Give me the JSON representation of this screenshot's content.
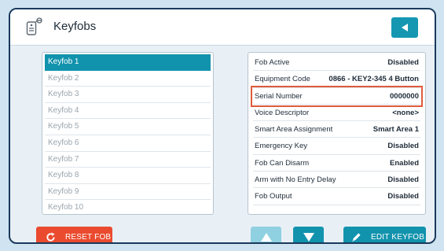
{
  "header": {
    "title": "Keyfobs"
  },
  "keyfobs": [
    "Keyfob 1",
    "Keyfob 2",
    "Keyfob 3",
    "Keyfob 4",
    "Keyfob 5",
    "Keyfob 6",
    "Keyfob 7",
    "Keyfob 8",
    "Keyfob 9",
    "Keyfob 10"
  ],
  "selected_index": 0,
  "details": [
    {
      "label": "Fob Active",
      "value": "Disabled"
    },
    {
      "label": "Equipment Code",
      "value": "0866 - KEY2-345 4 Button"
    },
    {
      "label": "Serial Number",
      "value": "0000000"
    },
    {
      "label": "Voice Descriptor",
      "value": "<none>"
    },
    {
      "label": "Smart Area Assignment",
      "value": "Smart Area 1"
    },
    {
      "label": "Emergency Key",
      "value": "Disabled"
    },
    {
      "label": "Fob Can Disarm",
      "value": "Enabled"
    },
    {
      "label": "Arm with No Entry Delay",
      "value": "Disabled"
    },
    {
      "label": "Fob Output",
      "value": "Disabled"
    }
  ],
  "highlighted_detail_index": 2,
  "buttons": {
    "reset": "RESET FOB",
    "edit": "EDIT KEYFOB"
  },
  "colors": {
    "accent": "#1293ad",
    "accent_disabled": "#8fd0e1",
    "danger": "#ea4b2f",
    "highlight": "#e05a3a"
  }
}
